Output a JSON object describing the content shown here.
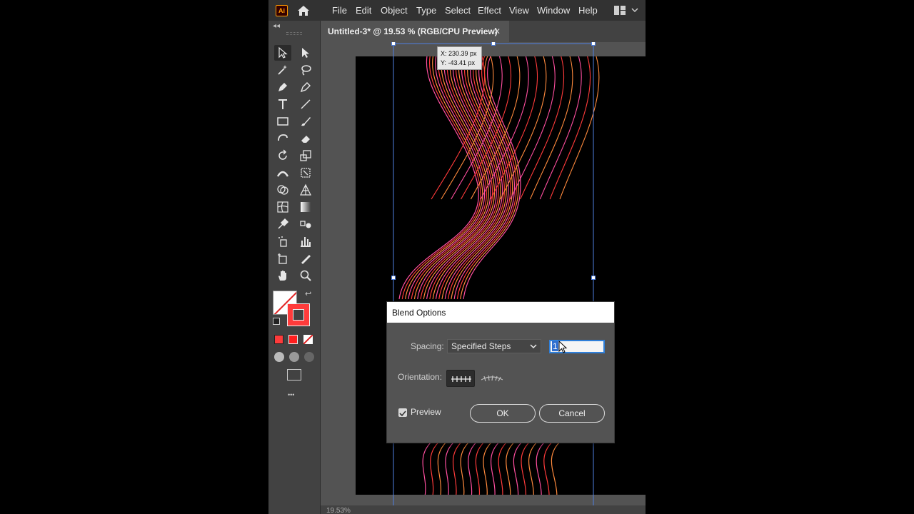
{
  "app": {
    "logo_text": "Ai",
    "menu": [
      "File",
      "Edit",
      "Object",
      "Type",
      "Select",
      "Effect",
      "View",
      "Window",
      "Help"
    ]
  },
  "document_tab": {
    "title": "Untitled-3* @ 19.53 % (RGB/CPU Preview)",
    "close": "✕"
  },
  "canvas": {
    "tooltip_x": "X: 230.39 px",
    "tooltip_y": "Y: -43.41 px"
  },
  "blend_dialog": {
    "title": "Blend Options",
    "spacing_label": "Spacing:",
    "spacing_value": "Specified Steps",
    "steps_value": "1",
    "orientation_label": "Orientation:",
    "preview_label": "Preview",
    "preview_checked": true,
    "ok_label": "OK",
    "cancel_label": "Cancel"
  },
  "toolbar": {
    "collapse": "◂◂",
    "more": "•••"
  },
  "statusbar": {
    "zoom": "19.53%"
  },
  "colors": {
    "accent": "#2f7fd9",
    "stroke_red": "#ff3b3b",
    "stroke_orange": "#ff8a3d",
    "stroke_pink": "#ff4fa0"
  }
}
